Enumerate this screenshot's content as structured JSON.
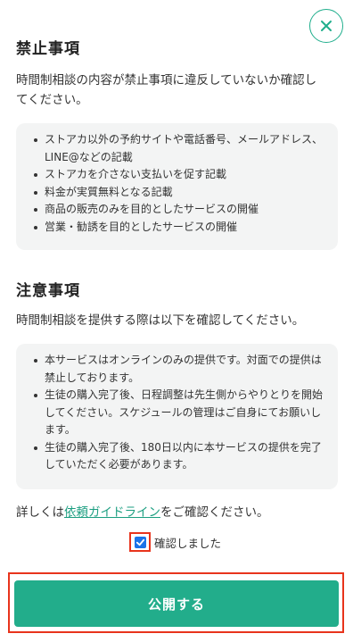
{
  "close_button": {
    "icon": "close-icon"
  },
  "prohibited": {
    "title": "禁止事項",
    "intro_line1": "時間制相談の内容が禁止事項に違反していないか確認し",
    "intro_line2": "てください。",
    "items": [
      "ストアカ以外の予約サイトや電話番号、メールアドレス、LINE@などの記載",
      "ストアカを介さない支払いを促す記載",
      "料金が実質無料となる記載",
      "商品の販売のみを目的としたサービスの開催",
      "営業・勧誘を目的としたサービスの開催"
    ]
  },
  "notes": {
    "title": "注意事項",
    "intro": "時間制相談を提供する際は以下を確認してください。",
    "items": [
      "本サービスはオンラインのみの提供です。対面での提供は禁止しております。",
      "生徒の購入完了後、日程調整は先生側からやりとりを開始してください。スケジュールの管理はご自身にてお願いします。",
      "生徒の購入完了後、180日以内に本サービスの提供を完了していただく必要があります。"
    ]
  },
  "guideline": {
    "prefix": "詳しくは",
    "link_text": "依頼ガイドライン",
    "suffix": "をご確認ください。"
  },
  "confirm": {
    "label": "確認しました",
    "checked": true
  },
  "publish_button": {
    "label": "公開する"
  },
  "colors": {
    "accent": "#22ad8b",
    "link": "#1b9e80",
    "highlight": "#e8341c",
    "checkbox": "#1a73e8"
  }
}
